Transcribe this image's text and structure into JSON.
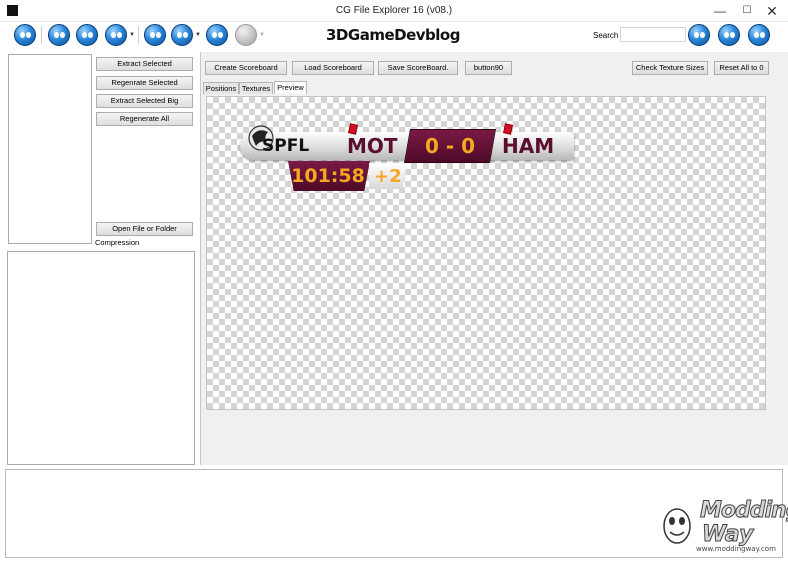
{
  "window": {
    "title": "CG File Explorer 16 (v08.)",
    "minimize": "—",
    "maximize": "☐",
    "close": "✕"
  },
  "toolbar": {
    "logo": "3DGameDevblog",
    "search_label": "Search",
    "search_value": "",
    "dropdown_arrow": "▼"
  },
  "left": {
    "extract_selected": "Extract Selected",
    "regenrate_selected": "Regenrate Selected",
    "extract_selected_big": "Extract Selected Big",
    "regenerate_all": "Regenerate All",
    "open_file_or_folder": "Open File or Folder",
    "compression_label": "Compression"
  },
  "right": {
    "create_scoreboard": "Create Scoreboard",
    "load_scoreboard": "Load Scoreboard",
    "save_scoreboard": "Save ScoreBoard.",
    "button90": "button90",
    "check_texture_sizes": "Check Texture Sizes",
    "reset_all": "Reset All to 0",
    "tabs": [
      "Positions",
      "Textures",
      "Preview"
    ],
    "active_tab": "Preview"
  },
  "scoreboard": {
    "league": "SPFL",
    "home": "MOT",
    "score": "0 - 0",
    "away": "HAM",
    "time": "101:58",
    "added_time": "+2",
    "colors": {
      "primary": "#5b0f2e",
      "accent": "#f5a623",
      "card": "#d0102a"
    }
  },
  "watermark": {
    "line1": "Modding",
    "line2": "Way",
    "url": "www.moddingway.com"
  }
}
